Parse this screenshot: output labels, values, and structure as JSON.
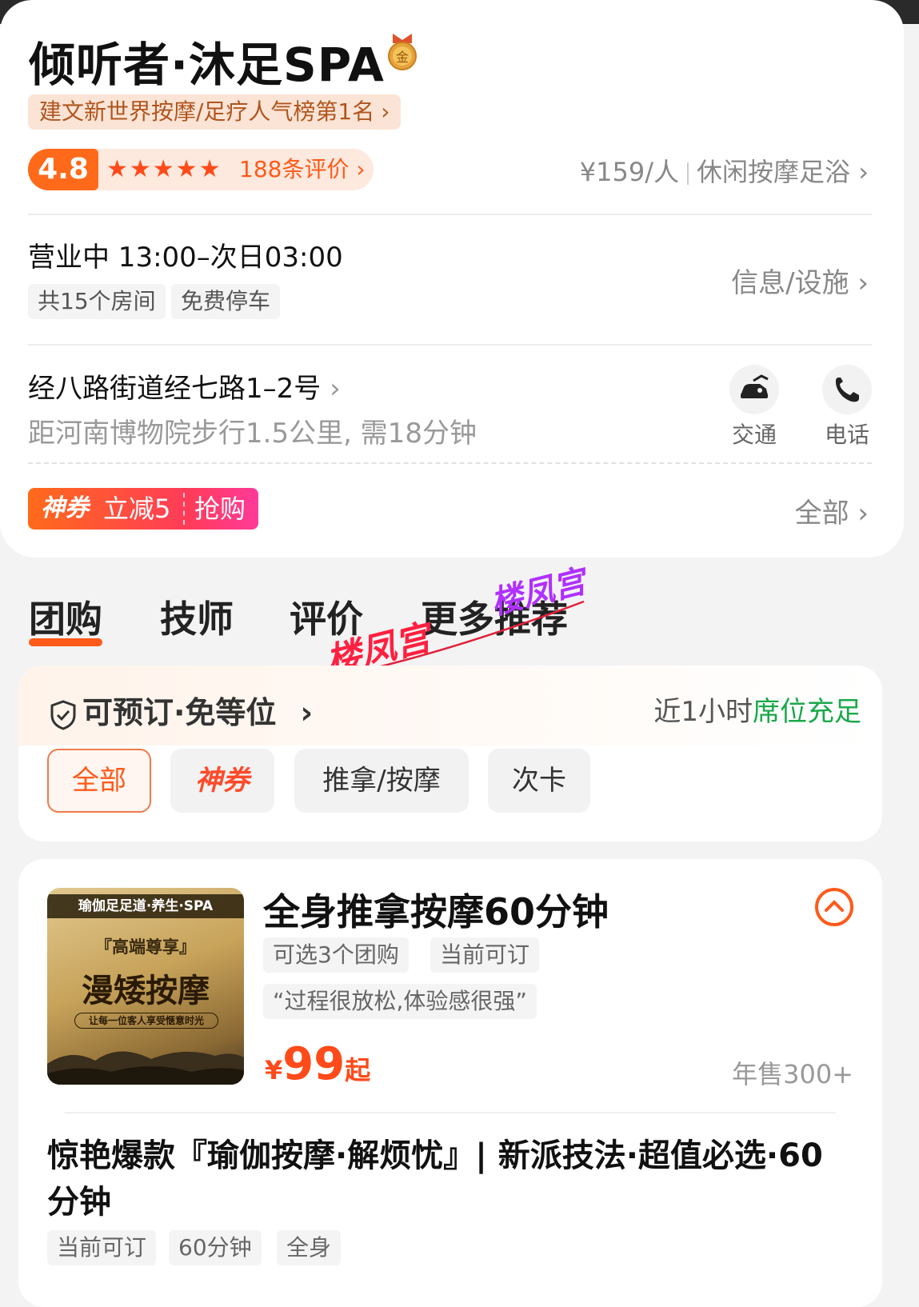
{
  "store": {
    "name": "倾听者·沐足SPA",
    "badge": "金",
    "rank_text": "建文新世界按摩/足疗人气榜第1名",
    "rating": "4.8",
    "stars": "★★★★★",
    "star_rating": 5,
    "reviews": "188条评价",
    "price": "¥159/人",
    "category": "休闲按摩足浴",
    "status_hours": "营业中 13:00–次日03:00",
    "tags": [
      "共15个房间",
      "免费停车"
    ],
    "info_link": "信息/设施",
    "address": "经八路街道经七路1–2号",
    "distance": "距河南博物院步行1.5公里, 需18分钟",
    "transport_label": "交通",
    "phone_label": "电话",
    "coupon": {
      "brand": "神券",
      "offer": "立减5",
      "action": "抢购"
    },
    "all_link": "全部"
  },
  "tabs": [
    "团购",
    "技师",
    "评价",
    "更多推荐"
  ],
  "watermark": "楼凤宫",
  "booking": {
    "title": "可预订·免等位",
    "near_prefix": "近1小时",
    "near_status": "席位充足",
    "filters": [
      "全部",
      "神券",
      "推拿/按摩",
      "次卡"
    ]
  },
  "deal1": {
    "thumb_brand": "瑜伽足足道·养生·SPA",
    "thumb_sub": "『高端尊享』",
    "thumb_main": "漫矮按摩",
    "thumb_slogan": "让每一位客人享受惬意时光",
    "title": "全身推拿按摩60分钟",
    "chips": [
      "可选3个团购",
      "当前可订"
    ],
    "quote": "“过程很放松,体验感很强”",
    "price_symbol": "¥",
    "price": "99",
    "price_suffix": "起",
    "sales": "年售300+"
  },
  "deal2": {
    "title": "惊艳爆款『瑜伽按摩·解烦忧』| 新派技法·超值必选·60分钟",
    "chips": [
      "当前可订",
      "60分钟",
      "全身"
    ]
  },
  "colors": {
    "accent": "#ff5a1a",
    "green": "#1aa84a",
    "rank_bg": "#fbe4d5"
  }
}
